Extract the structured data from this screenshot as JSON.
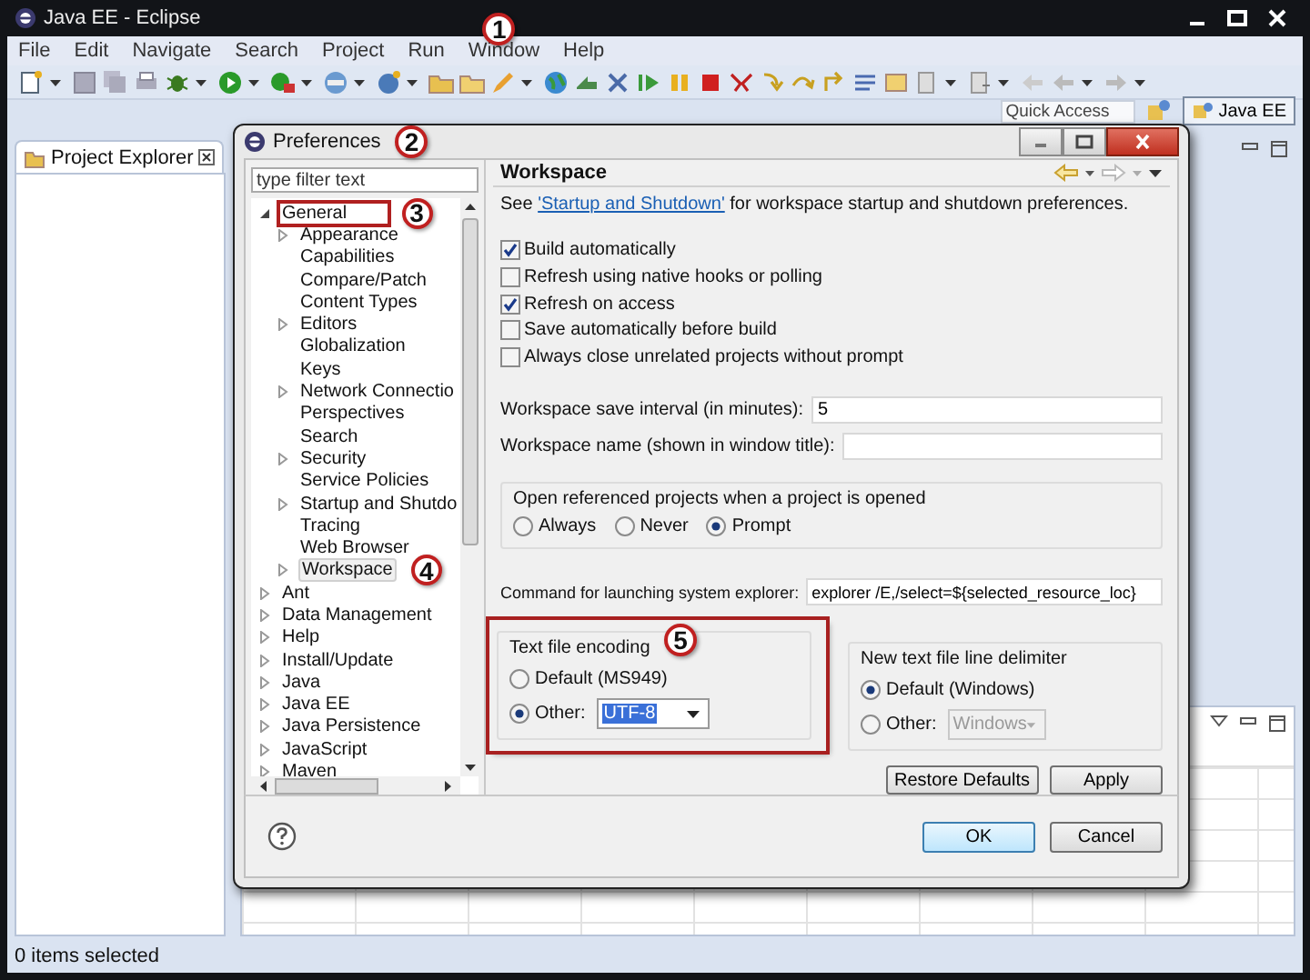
{
  "window": {
    "title": "Java EE - Eclipse"
  },
  "menu": [
    {
      "label": "File"
    },
    {
      "label": "Edit"
    },
    {
      "label": "Navigate"
    },
    {
      "label": "Search"
    },
    {
      "label": "Project"
    },
    {
      "label": "Run"
    },
    {
      "label": "Window",
      "callout": "1"
    },
    {
      "label": "Help"
    }
  ],
  "quick_access": {
    "placeholder": "Quick Access"
  },
  "perspective": {
    "label": "Java EE"
  },
  "project_explorer": {
    "title": "Project Explorer"
  },
  "status_bar": {
    "text": "0 items selected"
  },
  "dialog": {
    "title": "Preferences",
    "callout": "2",
    "filter": {
      "placeholder": "type filter text"
    },
    "tree": [
      {
        "label": "General",
        "expanded": true,
        "selected": false,
        "highlighted": true,
        "callout": "3",
        "children": [
          {
            "label": "Appearance",
            "expandable": true,
            "selected": false
          },
          {
            "label": "Capabilities",
            "expandable": false,
            "selected": false
          },
          {
            "label": "Compare/Patch",
            "expandable": false,
            "selected": false
          },
          {
            "label": "Content Types",
            "expandable": false,
            "selected": false
          },
          {
            "label": "Editors",
            "expandable": true,
            "selected": false
          },
          {
            "label": "Globalization",
            "expandable": false,
            "selected": false
          },
          {
            "label": "Keys",
            "expandable": false,
            "selected": false
          },
          {
            "label": "Network Connectio",
            "expandable": true,
            "selected": false
          },
          {
            "label": "Perspectives",
            "expandable": false,
            "selected": false
          },
          {
            "label": "Search",
            "expandable": false,
            "selected": false
          },
          {
            "label": "Security",
            "expandable": true,
            "selected": false
          },
          {
            "label": "Service Policies",
            "expandable": false,
            "selected": false
          },
          {
            "label": "Startup and Shutdo",
            "expandable": true,
            "selected": false
          },
          {
            "label": "Tracing",
            "expandable": false,
            "selected": false
          },
          {
            "label": "Web Browser",
            "expandable": false,
            "selected": false
          },
          {
            "label": "Workspace",
            "expandable": true,
            "selected": true,
            "callout": "4"
          }
        ]
      },
      {
        "label": "Ant",
        "expandable": true,
        "selected": false
      },
      {
        "label": "Data Management",
        "expandable": true,
        "selected": false
      },
      {
        "label": "Help",
        "expandable": true,
        "selected": false
      },
      {
        "label": "Install/Update",
        "expandable": true,
        "selected": false
      },
      {
        "label": "Java",
        "expandable": true,
        "selected": false
      },
      {
        "label": "Java EE",
        "expandable": true,
        "selected": false
      },
      {
        "label": "Java Persistence",
        "expandable": true,
        "selected": false
      },
      {
        "label": "JavaScript",
        "expandable": true,
        "selected": false
      },
      {
        "label": "Maven",
        "expandable": true,
        "selected": false
      }
    ],
    "page": {
      "title": "Workspace",
      "intro": {
        "before": "See ",
        "link": "'Startup and Shutdown'",
        "after": " for workspace startup and shutdown preferences."
      },
      "options": [
        {
          "label": "Build automatically",
          "checked": true
        },
        {
          "label": "Refresh using native hooks or polling",
          "checked": false
        },
        {
          "label": "Refresh on access",
          "checked": true
        },
        {
          "label": "Save automatically before build",
          "checked": false
        },
        {
          "label": "Always close unrelated projects without prompt",
          "checked": false
        }
      ],
      "fields": [
        {
          "label": "Workspace save interval (in minutes):",
          "value": "5"
        },
        {
          "label": "Workspace name (shown in window title):"
        }
      ],
      "open_referenced": {
        "title": "Open referenced projects when a project is opened",
        "choices": [
          {
            "label": "Always",
            "selected": false
          },
          {
            "label": "Never",
            "selected": false
          },
          {
            "label": "Prompt",
            "selected": true
          }
        ]
      },
      "command": {
        "label": "Command for launching system explorer:",
        "value": "explorer /E,/select=${selected_resource_loc}"
      },
      "encoding": {
        "title": "Text file encoding",
        "highlighted": true,
        "callout": "5",
        "choices": [
          {
            "label": "Default (MS949)",
            "selected": false
          },
          {
            "label": "Other:",
            "selected": true,
            "value": "UTF-8",
            "disabled": false
          }
        ]
      },
      "delimiter": {
        "title": "New text file line delimiter",
        "highlighted": false,
        "choices": [
          {
            "label": "Default (Windows)",
            "selected": true
          },
          {
            "label": "Other:",
            "selected": false,
            "value": "Windows",
            "disabled": true
          }
        ]
      },
      "buttons": [
        {
          "label": "Restore Defaults"
        },
        {
          "label": "Apply"
        }
      ]
    },
    "footer_buttons": [
      {
        "label": "OK",
        "default": true
      },
      {
        "label": "Cancel",
        "default": false
      }
    ]
  }
}
